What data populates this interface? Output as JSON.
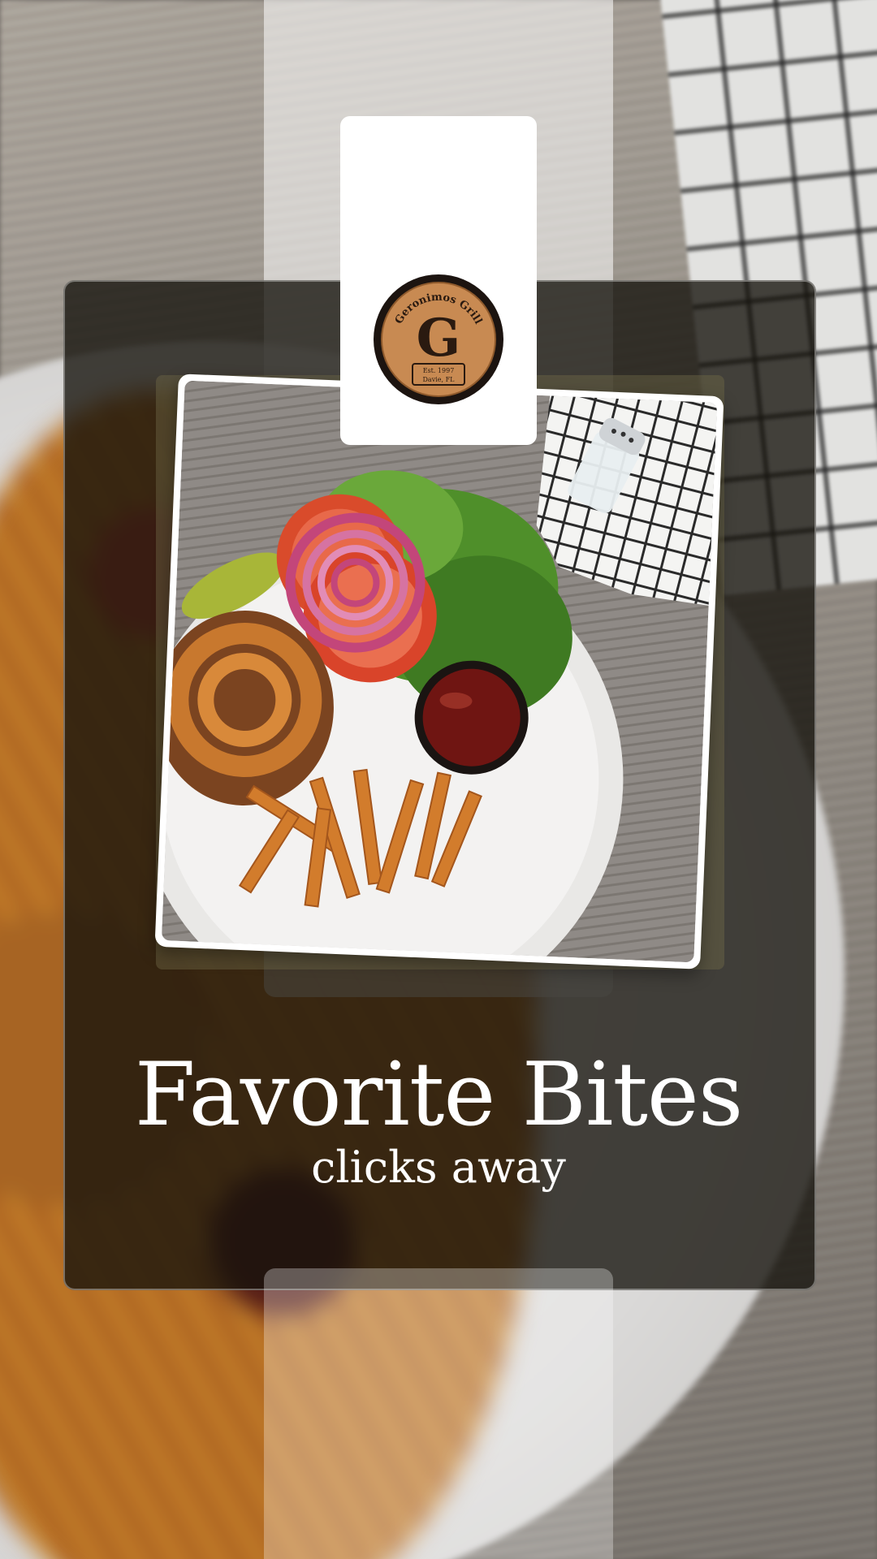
{
  "brand": {
    "name": "Geronimos Grill",
    "initial": "G",
    "established": "Est. 1997",
    "location": "Davie, FL"
  },
  "hero": {
    "headline": "Favorite Bites",
    "subline": "clicks away"
  },
  "colors": {
    "card": "#14120c",
    "text": "#ffffff",
    "logo_ring": "#1c1410",
    "logo_wood": "#c88a52"
  },
  "images": {
    "photo": "burger-fries-plate-photo",
    "background": "blurred-burger-plate-background"
  }
}
